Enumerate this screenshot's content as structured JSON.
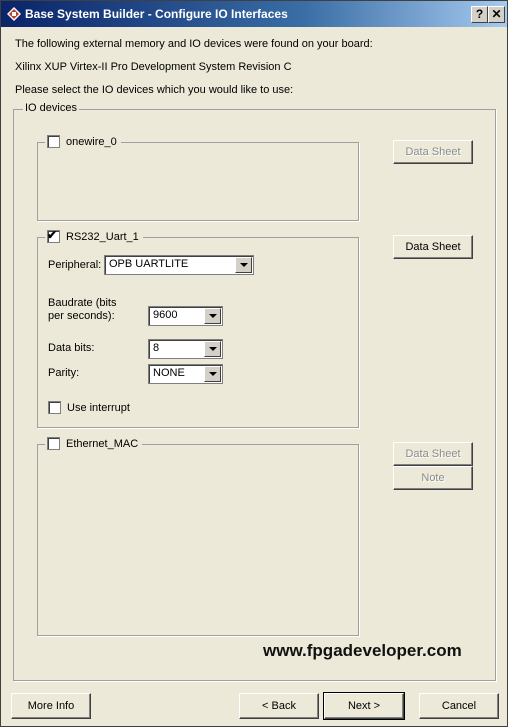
{
  "window": {
    "title": "Base System Builder - Configure IO Interfaces",
    "help_label": "?",
    "close_label": "✕"
  },
  "intro": {
    "line1": "The following external memory and IO devices were found on your board:",
    "line2": "Xilinx XUP Virtex-II Pro Development System Revision C",
    "line3": "Please select the IO devices which you would like to use:"
  },
  "io_group_label": "IO devices",
  "devices": {
    "onewire": {
      "label": "onewire_0",
      "checked": false,
      "datasheet_label": "Data Sheet",
      "datasheet_enabled": false
    },
    "rs232": {
      "label": "RS232_Uart_1",
      "checked": true,
      "datasheet_label": "Data Sheet",
      "datasheet_enabled": true,
      "peripheral_label": "Peripheral:",
      "peripheral_value": "OPB UARTLITE",
      "baudrate_label_1": "Baudrate (bits",
      "baudrate_label_2": "per seconds):",
      "baudrate_value": "9600",
      "databits_label": "Data bits:",
      "databits_value": "8",
      "parity_label": "Parity:",
      "parity_value": "NONE",
      "use_interrupt_label": "Use interrupt",
      "use_interrupt_checked": false
    },
    "ethernet": {
      "label": "Ethernet_MAC",
      "checked": false,
      "datasheet_label": "Data Sheet",
      "datasheet_enabled": false,
      "note_label": "Note",
      "note_enabled": false
    }
  },
  "check_glyph": "✔",
  "watermark": "www.fpgadeveloper.com",
  "footer": {
    "more_info": "More Info",
    "back": "< Back",
    "next": "Next >",
    "cancel": "Cancel"
  }
}
